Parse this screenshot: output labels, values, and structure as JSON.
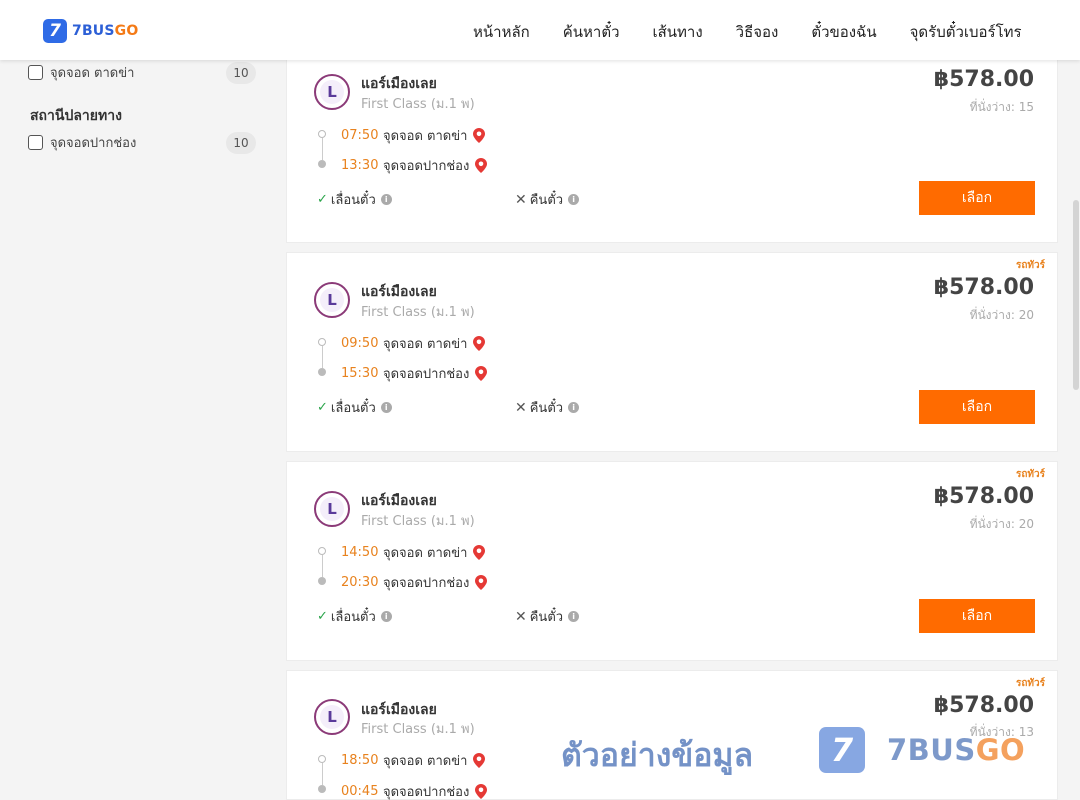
{
  "header": {
    "logo_text": "7BUS",
    "logo_text_go": "GO",
    "logo_badge": "7",
    "nav": [
      "หน้าหลัก",
      "ค้นหาตั๋ว",
      "เส้นทาง",
      "วิธีจอง",
      "ตั๋วของฉัน",
      "จุดรับตั๋วเบอร์โทร"
    ]
  },
  "sidebar": {
    "origin_filter": {
      "label": "จุดจอด ตาดข่า",
      "count": "10"
    },
    "destination_title": "สถานีปลายทาง",
    "destination_filter": {
      "label": "จุดจอดปากช่อง",
      "count": "10"
    }
  },
  "trips": [
    {
      "tag": "",
      "operator": "แอร์เมืองเลย",
      "class": "First Class (ม.1 พ)",
      "price": "฿578.00",
      "seats": "ที่นั่งว่าง: 15",
      "depart_time": "07:50",
      "depart_stop": "จุดจอด ตาดข่า",
      "arrive_time": "13:30",
      "arrive_stop": "จุดจอดปากช่อง",
      "reschedule": "เลื่อนตั๋ว",
      "refund": "คืนตั๋ว",
      "button": "เลือก"
    },
    {
      "tag": "รถทัวร์",
      "operator": "แอร์เมืองเลย",
      "class": "First Class (ม.1 พ)",
      "price": "฿578.00",
      "seats": "ที่นั่งว่าง: 20",
      "depart_time": "09:50",
      "depart_stop": "จุดจอด ตาดข่า",
      "arrive_time": "15:30",
      "arrive_stop": "จุดจอดปากช่อง",
      "reschedule": "เลื่อนตั๋ว",
      "refund": "คืนตั๋ว",
      "button": "เลือก"
    },
    {
      "tag": "รถทัวร์",
      "operator": "แอร์เมืองเลย",
      "class": "First Class (ม.1 พ)",
      "price": "฿578.00",
      "seats": "ที่นั่งว่าง: 20",
      "depart_time": "14:50",
      "depart_stop": "จุดจอด ตาดข่า",
      "arrive_time": "20:30",
      "arrive_stop": "จุดจอดปากช่อง",
      "reschedule": "เลื่อนตั๋ว",
      "refund": "คืนตั๋ว",
      "button": "เลือก"
    },
    {
      "tag": "รถทัวร์",
      "operator": "แอร์เมืองเลย",
      "class": "First Class (ม.1 พ)",
      "price": "฿578.00",
      "seats": "ที่นั่งว่าง: 13",
      "depart_time": "18:50",
      "depart_stop": "จุดจอด ตาดข่า",
      "arrive_time": "00:45",
      "arrive_stop": "จุดจอดปากช่อง"
    }
  ],
  "watermark": {
    "text": "ตัวอย่างข้อมูล",
    "logo_badge": "7",
    "brand": "7BUS",
    "brand_go": "GO"
  }
}
